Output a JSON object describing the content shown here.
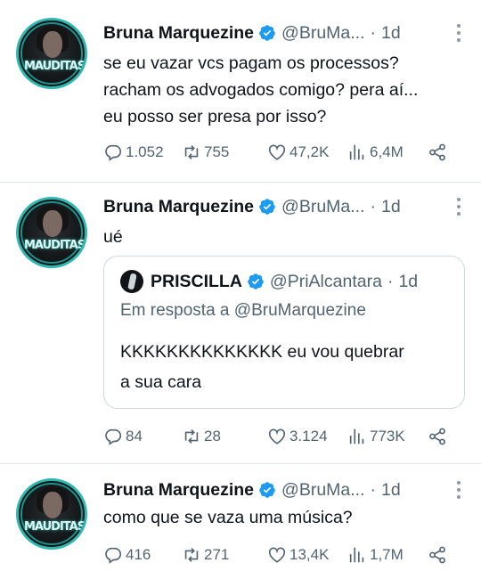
{
  "colors": {
    "verified": "#1d9bf0",
    "secondary": "#536471",
    "text": "#0f1419",
    "avatar_accent": "#2fb8b0"
  },
  "tweets": [
    {
      "author_name": "Bruna Marquezine",
      "handle": "@BruMa...",
      "separator": "·",
      "time": "1d",
      "avatar_text": "MAUDITAS",
      "text_lines": [
        "se eu vazar vcs pagam os processos?",
        "racham os advogados comigo? pera aí...",
        "eu posso ser presa por isso?"
      ],
      "replies": "1.052",
      "retweets": "755",
      "likes": "47,2K",
      "views": "6,4M"
    },
    {
      "author_name": "Bruna Marquezine",
      "handle": "@BruMa...",
      "separator": "·",
      "time": "1d",
      "avatar_text": "MAUDITAS",
      "text_lines": [
        "ué"
      ],
      "quote": {
        "author_name": "PRISCILLA",
        "handle": "@PriAlcantara",
        "separator": "·",
        "time": "1d",
        "reply_to": "Em resposta a @BruMarquezine",
        "text_lines": [
          "KKKKKKKKKKKKKK eu vou quebrar",
          "a sua cara"
        ]
      },
      "replies": "84",
      "retweets": "28",
      "likes": "3.124",
      "views": "773K"
    },
    {
      "author_name": "Bruna Marquezine",
      "handle": "@BruMa...",
      "separator": "·",
      "time": "1d",
      "avatar_text": "MAUDITAS",
      "text_lines": [
        "como que se vaza uma música?"
      ],
      "replies": "416",
      "retweets": "271",
      "likes": "13,4K",
      "views": "1,7M"
    }
  ]
}
